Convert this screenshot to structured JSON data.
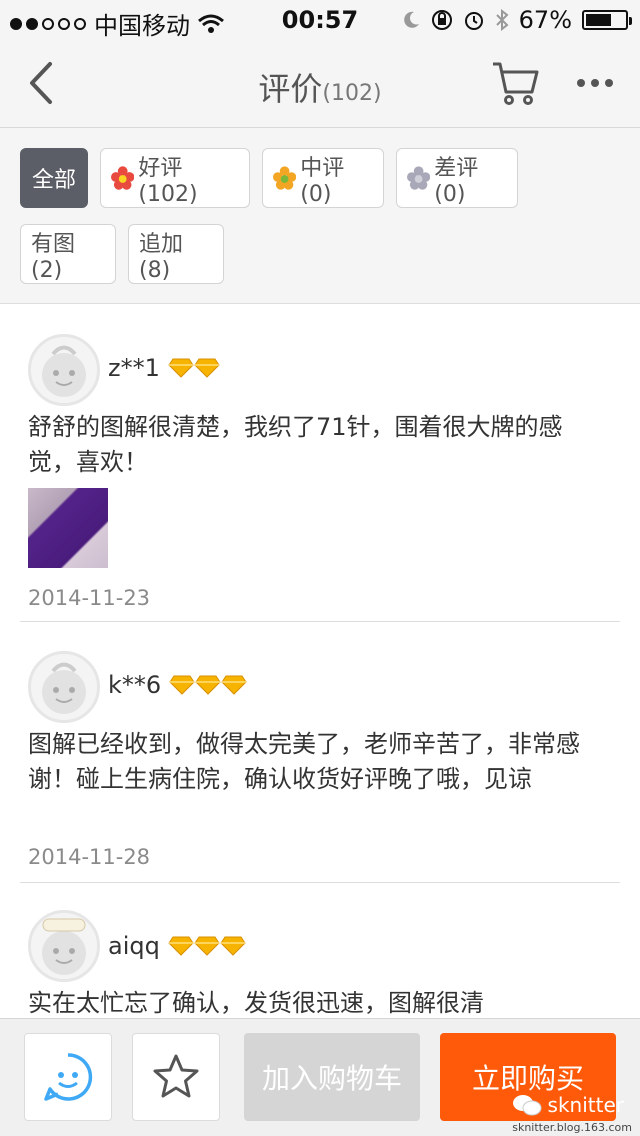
{
  "status_bar": {
    "carrier": "中国移动",
    "time": "00:57",
    "battery": "67%",
    "battery_level": 0.67
  },
  "nav": {
    "title": "评价",
    "count": "(102)",
    "icons": [
      "back-arrow-icon",
      "cart-icon",
      "more-dots-icon"
    ]
  },
  "filters": {
    "all": "全部",
    "good": "好评(102)",
    "medium": "中评(0)",
    "bad": "差评(0)",
    "with_pics": "有图(2)",
    "appended": "追加(8)"
  },
  "reviews": [
    {
      "user": "z**1",
      "gem_count": 2,
      "text": "舒舒的图解很清楚，我织了71针，围着很大牌的感觉，喜欢！",
      "date": "2014-11-23",
      "has_image": true
    },
    {
      "user": "k**6",
      "gem_count": 3,
      "text": "图解已经收到，做得太完美了，老师辛苦了，非常感谢！碰上生病住院，确认收货好评晚了哦，见谅",
      "date": "2014-11-28",
      "has_image": false
    },
    {
      "user": "aiqq",
      "gem_count": 3,
      "text": "实在太忙忘了确认，发货很迅速，图解很清",
      "date": "",
      "has_image": false
    }
  ],
  "bottom_bar": {
    "add_to_cart": "加入购物车",
    "buy_now": "立即购买",
    "watermark": "sknitter",
    "watermark_url": "sknitter.blog.163.com"
  },
  "colors": {
    "active_chip": "#5b5e66",
    "buy_button": "#ff5a0a",
    "cart_button": "#d5d5d5",
    "chat_icon": "#3fa9f5"
  }
}
